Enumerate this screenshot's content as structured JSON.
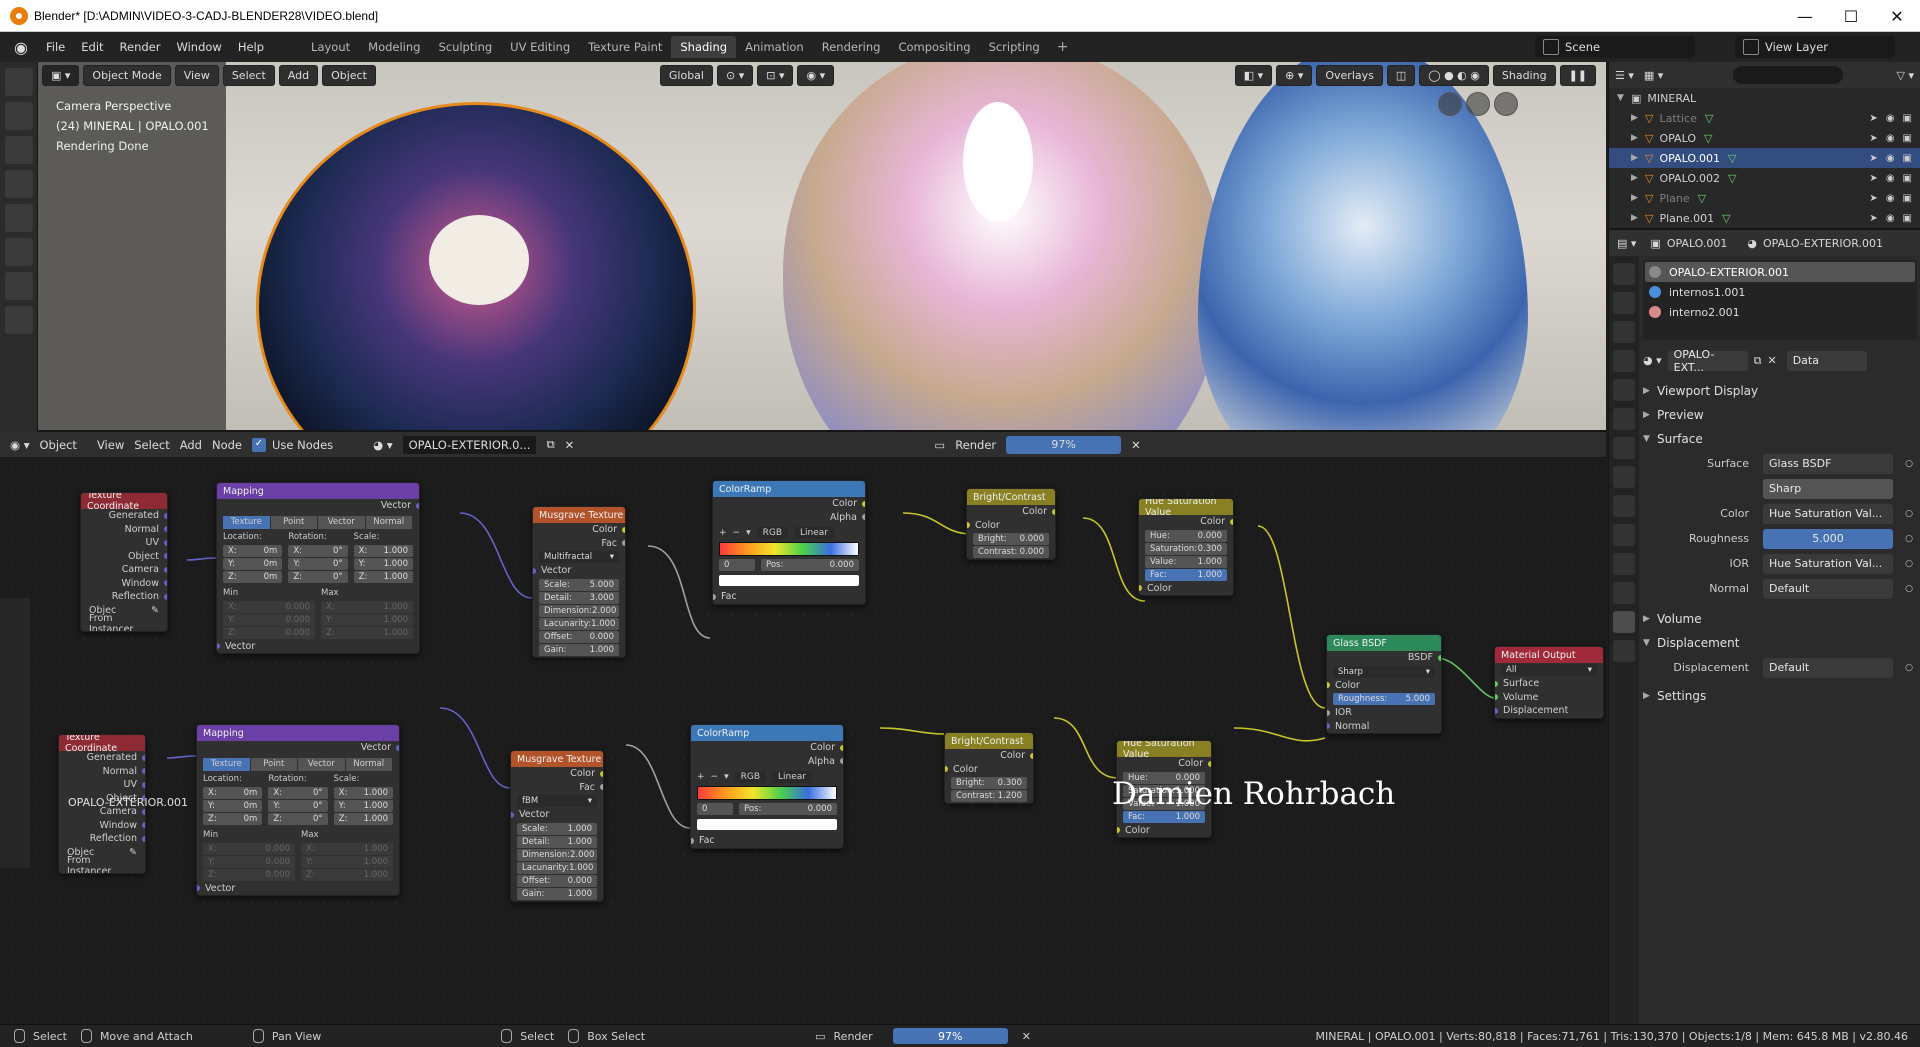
{
  "window": {
    "title": "Blender* [D:\\ADMIN\\VIDEO-3-CADJ-BLENDER28\\VIDEO.blend]",
    "minimize": "—",
    "maximize": "☐",
    "close": "✕"
  },
  "menubar": {
    "menus": [
      "File",
      "Edit",
      "Render",
      "Window",
      "Help"
    ],
    "workspaces": [
      "Layout",
      "Modeling",
      "Sculpting",
      "UV Editing",
      "Texture Paint",
      "Shading",
      "Animation",
      "Rendering",
      "Compositing",
      "Scripting"
    ],
    "active_workspace": "Shading",
    "add_workspace": "+",
    "scene": "Scene",
    "view_layer": "View Layer"
  },
  "viewport": {
    "mode": "Object Mode",
    "menus": [
      "View",
      "Select",
      "Add",
      "Object"
    ],
    "transform": "Global",
    "overlays": "Overlays",
    "shading": "Shading",
    "info": [
      "Camera Perspective",
      "(24) MINERAL | OPALO.001",
      "Rendering Done"
    ]
  },
  "outliner": {
    "collection": "MINERAL",
    "items": [
      {
        "name": "Lattice",
        "state": "dim"
      },
      {
        "name": "OPALO",
        "state": "normal"
      },
      {
        "name": "OPALO.001",
        "state": "selected"
      },
      {
        "name": "OPALO.002",
        "state": "normal"
      },
      {
        "name": "Plane",
        "state": "dim"
      },
      {
        "name": "Plane.001",
        "state": "normal"
      }
    ]
  },
  "properties": {
    "object": "OPALO.001",
    "material": "OPALO-EXTERIOR.001",
    "materials": [
      {
        "name": "OPALO-EXTERIOR.001",
        "color": "#8a8a8a"
      },
      {
        "name": "internos1.001",
        "color": "#4a90d9"
      },
      {
        "name": "interno2.001",
        "color": "#d98a8a"
      }
    ],
    "slot_material": "OPALO-EXT...",
    "link": "Data",
    "sections": {
      "viewport_display": "Viewport Display",
      "preview": "Preview",
      "surface": "Surface",
      "volume": "Volume",
      "displacement": "Displacement",
      "settings": "Settings"
    },
    "surface_label": "Surface",
    "surface_value": "Glass BSDF",
    "distribution": "Sharp",
    "color_label": "Color",
    "color_value": "Hue Saturation Val...",
    "roughness_label": "Roughness",
    "roughness_value": "5.000",
    "ior_label": "IOR",
    "ior_value": "Hue Saturation Val...",
    "normal_label": "Normal",
    "normal_value": "Default",
    "displacement_label": "Displacement",
    "displacement_value": "Default"
  },
  "node_header": {
    "editor_type": "Object",
    "menus": [
      "View",
      "Select",
      "Add",
      "Node"
    ],
    "use_nodes": "Use Nodes",
    "material": "OPALO-EXTERIOR.0...",
    "render_label": "Render",
    "render_progress": "97%"
  },
  "nodes": {
    "tex_coord_title": "Texture Coordinate",
    "tex_coord_outputs": [
      "Generated",
      "Normal",
      "UV",
      "Object",
      "Camera",
      "Window",
      "Reflection"
    ],
    "object_label": "Objec",
    "from_instancer": "From Instancer",
    "mapping_title": "Mapping",
    "vector": "Vector",
    "mapping_tabs": [
      "Texture",
      "Point",
      "Vector",
      "Normal"
    ],
    "location": "Location:",
    "rotation": "Rotation:",
    "scale": "Scale:",
    "loc_vals": [
      [
        "X:",
        "0m"
      ],
      [
        "Y:",
        "0m"
      ],
      [
        "Z:",
        "0m"
      ]
    ],
    "rot_vals": [
      [
        "X:",
        "0°"
      ],
      [
        "Y:",
        "0°"
      ],
      [
        "Z:",
        "0°"
      ]
    ],
    "scale_vals": [
      [
        "X:",
        "1.000"
      ],
      [
        "Y:",
        "1.000"
      ],
      [
        "Z:",
        "1.000"
      ]
    ],
    "min": "Min",
    "max": "Max",
    "min_vals": [
      [
        "X:",
        "0.000"
      ],
      [
        "Y:",
        "0.000"
      ],
      [
        "Z:",
        "0.000"
      ]
    ],
    "max_vals": [
      [
        "X:",
        "1.000"
      ],
      [
        "Y:",
        "1.000"
      ],
      [
        "Z:",
        "1.000"
      ]
    ],
    "musgrave_title": "Musgrave Texture",
    "color": "Color",
    "fac": "Fac",
    "alpha": "Alpha",
    "musgrave1_type": "Multifractal",
    "musgrave2_type": "fBM",
    "musgrave1": [
      [
        "Scale:",
        "5.000"
      ],
      [
        "Detail:",
        "3.000"
      ],
      [
        "Dimension:",
        "2.000"
      ],
      [
        "Lacunarity:",
        "1.000"
      ],
      [
        "Offset:",
        "0.000"
      ],
      [
        "Gain:",
        "1.000"
      ]
    ],
    "musgrave2": [
      [
        "Scale:",
        "1.000"
      ],
      [
        "Detail:",
        "1.000"
      ],
      [
        "Dimension:",
        "2.000"
      ],
      [
        "Lacunarity:",
        "1.000"
      ],
      [
        "Offset:",
        "0.000"
      ],
      [
        "Gain:",
        "1.000"
      ]
    ],
    "colorramp_title": "ColorRamp",
    "ramp_mode": "RGB",
    "ramp_interp": "Linear",
    "ramp_index": "0",
    "ramp_pos_label": "Pos:",
    "ramp_pos": "0.000",
    "bc_title": "Bright/Contrast",
    "bc1": [
      [
        "Bright:",
        "0.000"
      ],
      [
        "Contrast:",
        "0.000"
      ]
    ],
    "bc2": [
      [
        "Bright:",
        "0.300"
      ],
      [
        "Contrast:",
        "1.200"
      ]
    ],
    "hsv_title": "Hue Saturation Value",
    "hsv1": [
      [
        "Hue:",
        "0.000"
      ],
      [
        "Saturation:",
        "0.300"
      ],
      [
        "Value:",
        "1.000"
      ],
      [
        "Fac:",
        "1.000"
      ]
    ],
    "hsv2": [
      [
        "Hue:",
        "0.000"
      ],
      [
        "Saturation:",
        "1.000"
      ],
      [
        "Value:",
        "1.000"
      ],
      [
        "Fac:",
        "1.000"
      ]
    ],
    "glass_title": "Glass BSDF",
    "bsdf": "BSDF",
    "glass_dist": "Sharp",
    "glass_roughness": [
      "Roughness:",
      "5.000"
    ],
    "ior": "IOR",
    "normal": "Normal",
    "output_title": "Material Output",
    "output_target": "All",
    "surface": "Surface",
    "volume": "Volume",
    "displacement": "Displacement"
  },
  "node_frame_label": "OPALO-EXTERIOR.001",
  "signature": "Damien Rohrbach",
  "statusbar": {
    "select": "Select",
    "move_attach": "Move and Attach",
    "pan_view": "Pan View",
    "select2": "Select",
    "box_select": "Box Select",
    "render": "Render",
    "progress": "97%",
    "stats": "MINERAL | OPALO.001 | Verts:80,818 | Faces:71,761 | Tris:130,370 | Objects:1/8 | Mem: 645.8 MB | v2.80.46"
  }
}
